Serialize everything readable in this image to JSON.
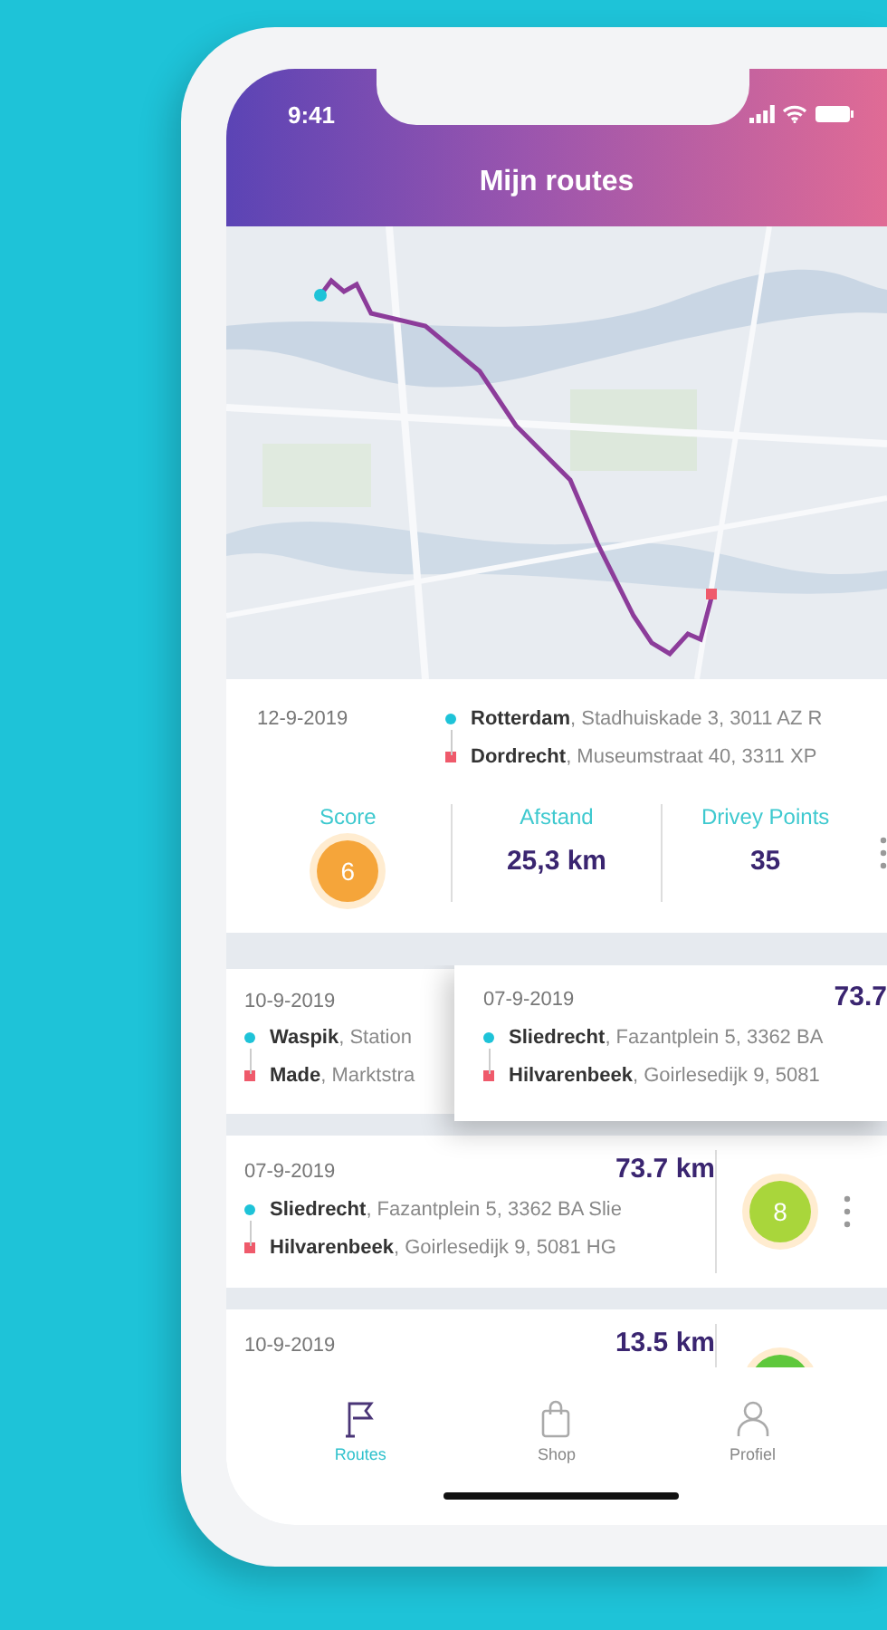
{
  "status_bar": {
    "time": "9:41"
  },
  "header": {
    "title": "Mijn routes"
  },
  "selected_route": {
    "date": "12-9-2019",
    "stops": [
      {
        "kind": "start",
        "text": "**Rotterdam**, Stadhuiskade 3, 3011 AZ R"
      },
      {
        "kind": "end",
        "text": "**Dordrecht**, Museumstraat 40, 3311 XP"
      }
    ],
    "stats": [
      {
        "kind": "score",
        "label": "Score",
        "value": "6",
        "color": "#f5a53a"
      },
      {
        "kind": "text",
        "label": "Afstand",
        "value": "25,3 km"
      },
      {
        "kind": "text",
        "label": "Drivey Points",
        "value": "35"
      }
    ]
  },
  "routes": [
    {
      "kind": "swiped",
      "back": {
        "date": "10-9-2019",
        "stops": [
          {
            "kind": "start",
            "text": "**Waspik**, Station"
          },
          {
            "kind": "end",
            "text": "**Made**, Marktstra"
          }
        ]
      },
      "front": {
        "date": "07-9-2019",
        "distance": "73.7",
        "stops": [
          {
            "kind": "start",
            "text": "**Sliedrecht**, Fazantplein 5, 3362 BA"
          },
          {
            "kind": "end",
            "text": "**Hilvarenbeek**, Goirlesedijk 9, 5081"
          }
        ]
      }
    },
    {
      "kind": "normal",
      "date": "07-9-2019",
      "distance": "73.7 km",
      "stops": [
        {
          "kind": "start",
          "text": "**Sliedrecht**, Fazantplein 5, 3362 BA Slie"
        },
        {
          "kind": "end",
          "text": "**Hilvarenbeek**, Goirlesedijk 9, 5081 HG"
        }
      ],
      "score": {
        "value": "8",
        "color": "#a9d63b"
      }
    },
    {
      "kind": "normal",
      "date": "10-9-2019",
      "distance": "13.5 km",
      "score": {
        "color": "#5ec83c"
      }
    }
  ],
  "tab_bar": [
    {
      "kind": "flag",
      "label": "Routes",
      "selected": true
    },
    {
      "kind": "bag",
      "label": "Shop",
      "selected": false
    },
    {
      "kind": "person",
      "label": "Profiel",
      "selected": false
    }
  ]
}
